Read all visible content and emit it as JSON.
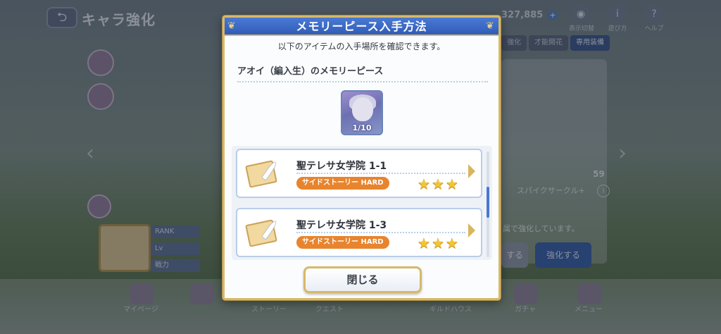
{
  "background": {
    "title": "キャラ強化",
    "currency_value": "327,885",
    "currency_plus": "+",
    "top_icons": [
      {
        "icon": "eye-icon",
        "label": "表示切替"
      },
      {
        "icon": "info-icon",
        "label": "遊び方"
      },
      {
        "icon": "question-icon",
        "label": "ヘルプ"
      }
    ],
    "tabs": [
      {
        "label": "強化"
      },
      {
        "label": "才能開花"
      },
      {
        "label": "専用装備"
      }
    ],
    "stat_number": "59",
    "skill_name": "スパイクサークル+",
    "panel_text": "属で強化しています。",
    "buttons": {
      "grey": "する",
      "blue": "強化する"
    },
    "stats": [
      {
        "label": "RANK"
      },
      {
        "label": "Lv"
      },
      {
        "label": "戦力"
      }
    ],
    "bottom_nav": [
      {
        "label": "マイページ"
      },
      {
        "label": "ストーリー"
      },
      {
        "label": "クエスト"
      },
      {
        "label": "ギルドハウス"
      },
      {
        "label": "ガチャ"
      },
      {
        "label": "メニュー"
      }
    ]
  },
  "modal": {
    "title": "メモリーピース入手方法",
    "subtitle": "以下のアイテムの入手場所を確認できます。",
    "item_name": "アオイ（編入生）のメモリーピース",
    "item_count": "1/10",
    "quests": [
      {
        "name": "聖テレサ女学院 1-1",
        "tag": "サイドストーリー HARD",
        "stars": 3
      },
      {
        "name": "聖テレサ女学院 1-3",
        "tag": "サイドストーリー HARD",
        "stars": 3
      }
    ],
    "close_label": "閉じる"
  },
  "colors": {
    "header_blue": "#2f5cb8",
    "gold_border": "#d8b86a",
    "tag_orange": "#e8842d",
    "star_gold": "#f4c432",
    "scroll_thumb": "#4a78cf"
  }
}
